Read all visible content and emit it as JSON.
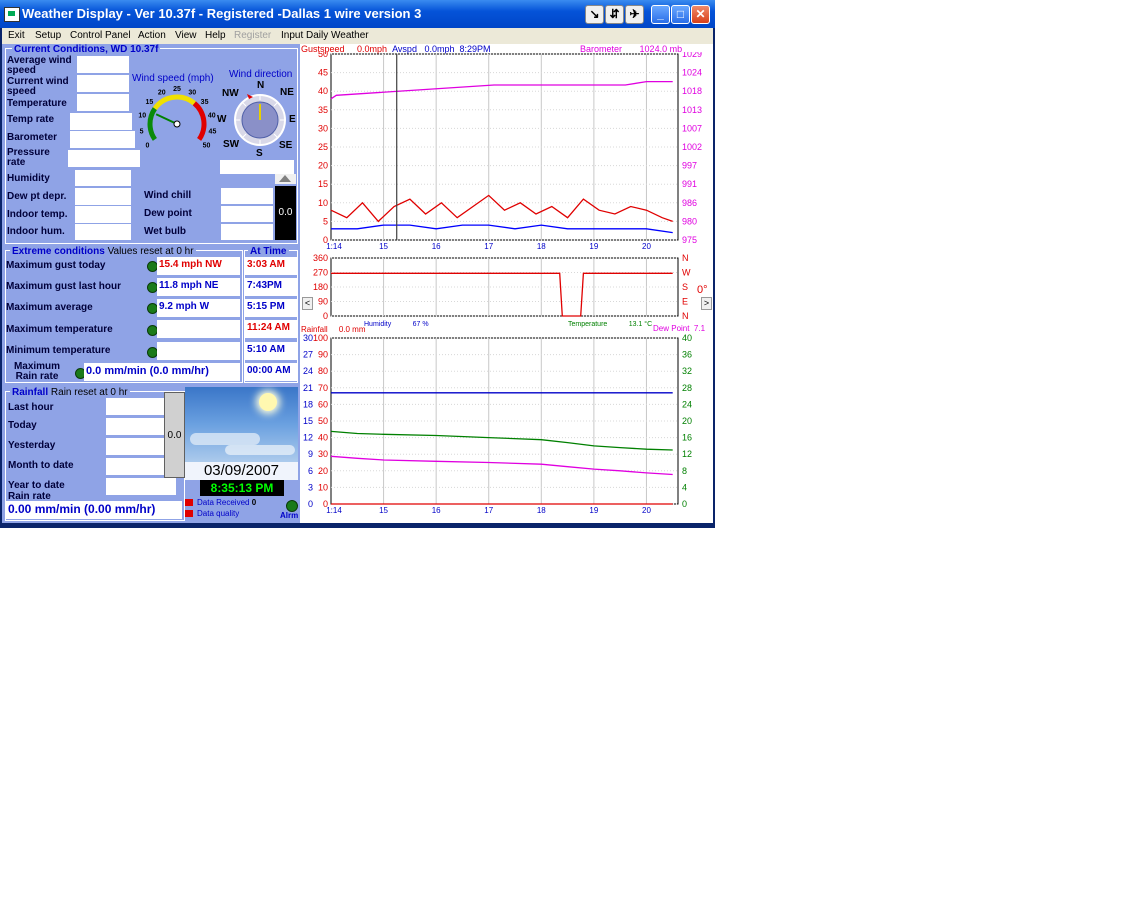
{
  "window": {
    "title": "Weather Display - Ver 10.37f - Registered  -Dallas 1 wire version 3"
  },
  "menu": [
    "Exit",
    "Setup",
    "Control Panel",
    "Action",
    "View",
    "Help",
    "Register",
    "Input Daily Weather"
  ],
  "current": {
    "title": "Current Conditions, WD 10.37f",
    "avg_wind_label": "Average wind speed",
    "cur_wind_label": "Current wind speed",
    "temperature_label": "Temperature",
    "temp_rate_label": "Temp rate",
    "barometer_label": "Barometer",
    "pressure_rate_label": "Pressure rate",
    "humidity_label": "Humidity",
    "dew_depr_label": "Dew pt depr.",
    "indoor_temp_label": "Indoor temp.",
    "indoor_hum_label": "Indoor hum.",
    "wind_chill_label": "Wind chill",
    "dew_point_label": "Dew point",
    "wet_bulb_label": "Wet bulb",
    "gauge_value": "0.0"
  },
  "wind_gauge": {
    "title": "Wind speed (mph)",
    "scale": [
      "0",
      "5",
      "10",
      "15",
      "20",
      "25",
      "30",
      "35",
      "40",
      "45",
      "50"
    ],
    "needle_value": 12
  },
  "wind_dir": {
    "title": "Wind direction",
    "N": "N",
    "NE": "NE",
    "E": "E",
    "SE": "SE",
    "S": "S",
    "SW": "SW",
    "W": "W",
    "NW": "NW"
  },
  "extremes": {
    "title": "Extreme conditions",
    "subtitle": "Values reset at 0 hr",
    "at_time": "At Time",
    "rows": [
      {
        "label": "Maximum gust today",
        "value": "15.4 mph NW",
        "time": "3:03 AM",
        "color": "#e00000"
      },
      {
        "label": "Maximum gust last hour",
        "value": "11.8 mph NE",
        "time": "7:43PM",
        "color": "#0000c8"
      },
      {
        "label": "Maximum average",
        "value": "9.2 mph W",
        "time": "5:15 PM",
        "color": "#0000c8"
      },
      {
        "label": "Maximum temperature",
        "value": "",
        "time": "11:24 AM",
        "color": "#e00000"
      },
      {
        "label": "Minimum temperature",
        "value": "",
        "time": "5:10 AM",
        "color": "#0000c8"
      },
      {
        "label": "Maximum Rain rate",
        "value": "0.0 mm/min (0.0 mm/hr)",
        "time": "00:00 AM",
        "color": "#0000c8"
      }
    ]
  },
  "rainfall": {
    "title": "Rainfall",
    "subtitle": "Rain reset at 0 hr",
    "rows": [
      "Last hour",
      "Today",
      "Yesterday",
      "Month to date",
      "Year to date"
    ],
    "gauge_value": "0.0",
    "rate_label": "Rain rate",
    "rate_value": "0.00 mm/min (0.00 mm/hr)"
  },
  "status": {
    "date": "03/09/2007",
    "time": "8:35:13 PM",
    "data_received_label": "Data Received",
    "data_received_value": "0",
    "data_quality_label": "Data quality",
    "alarm_label": "Alrm"
  },
  "colors": {
    "panel": "#8fa3e6",
    "accent": "#0000c8",
    "red": "#e00000",
    "green": "#008000",
    "magenta": "#e000e0",
    "clock_bg": "#000000",
    "clock_fg": "#00ff00"
  },
  "chart_data": [
    {
      "type": "line",
      "header": {
        "gust_label": "Gustspeed",
        "gust_value": "0.0mph",
        "avg_label": "Avspd",
        "avg_value": "0.0mph",
        "time": "8:29PM",
        "baro_label": "Barometer",
        "baro_value": "1024.0 mb"
      },
      "x_ticks": [
        "1:14",
        "15",
        "16",
        "17",
        "18",
        "19",
        "20"
      ],
      "y_left_ticks": [
        "0",
        "5",
        "10",
        "15",
        "20",
        "25",
        "30",
        "35",
        "40",
        "45",
        "50"
      ],
      "y_right_ticks": [
        "975",
        "980",
        "986",
        "991",
        "997",
        "1002",
        "1007",
        "1013",
        "1018",
        "1024",
        "1029"
      ],
      "ylim": [
        0,
        50
      ],
      "y2lim": [
        975,
        1029
      ],
      "series": [
        {
          "name": "Gustspeed",
          "color": "#e00000",
          "x": [
            14.0,
            14.3,
            14.6,
            14.9,
            15.2,
            15.5,
            15.8,
            16.1,
            16.4,
            16.7,
            17.0,
            17.3,
            17.6,
            17.9,
            18.2,
            18.5,
            18.8,
            19.1,
            19.4,
            19.7,
            20.0,
            20.3,
            20.5
          ],
          "y": [
            8,
            6,
            10,
            5,
            9,
            11,
            7,
            10,
            6,
            9,
            12,
            8,
            10,
            7,
            9,
            6,
            11,
            8,
            7,
            9,
            8,
            6,
            5
          ]
        },
        {
          "name": "Avspd",
          "color": "#0000ff",
          "x": [
            14.0,
            14.5,
            15.0,
            15.5,
            16.0,
            16.5,
            17.0,
            17.5,
            18.0,
            18.5,
            19.0,
            19.5,
            20.0,
            20.5
          ],
          "y": [
            3,
            3,
            4,
            4,
            3,
            4,
            4,
            3,
            4,
            3,
            3,
            3,
            3,
            2
          ]
        },
        {
          "name": "Barometer",
          "color": "#e000e0",
          "x": [
            14.0,
            14.1,
            17.1,
            19.6,
            20.0,
            20.5
          ],
          "y": [
            1016,
            1017,
            1020,
            1020,
            1021,
            1021
          ]
        }
      ]
    },
    {
      "type": "line",
      "x_ticks": [
        "15",
        "16",
        "17",
        "18",
        "19",
        "20"
      ],
      "y_left_ticks": [
        "0",
        "90",
        "180",
        "270",
        "360"
      ],
      "y_right_ticks": [
        "N",
        "E",
        "S",
        "W",
        "N"
      ],
      "right_readout": "0°",
      "ylim": [
        0,
        360
      ],
      "series": [
        {
          "name": "Wind direction",
          "color": "#e00000",
          "x": [
            14.0,
            15.0,
            16.0,
            17.0,
            18.0,
            18.35,
            18.4,
            18.75,
            18.8,
            19.5,
            20.5
          ],
          "y": [
            265,
            265,
            265,
            265,
            265,
            265,
            0,
            0,
            265,
            265,
            265
          ]
        }
      ]
    },
    {
      "type": "line",
      "header": {
        "rain_label": "Rainfall",
        "rain_value": "0.0 mm",
        "hum_label": "Humidity",
        "hum_value": "67 %",
        "temp_label": "Temperature",
        "temp_value": "13.1 °C",
        "dew_label": "Dew Point",
        "dew_value": "7.1"
      },
      "x_ticks": [
        "1:14",
        "15",
        "16",
        "17",
        "18",
        "19",
        "20"
      ],
      "y_left_ticks": [
        "0",
        "10",
        "20",
        "30",
        "40",
        "50",
        "60",
        "70",
        "80",
        "90",
        "100"
      ],
      "y_left2_ticks": [
        "0",
        "3",
        "6",
        "9",
        "12",
        "15",
        "18",
        "21",
        "24",
        "27",
        "30"
      ],
      "y_right_ticks": [
        "0",
        "4",
        "8",
        "12",
        "16",
        "20",
        "24",
        "28",
        "32",
        "36",
        "40"
      ],
      "ylim": [
        0,
        100
      ],
      "y2lim": [
        0,
        40
      ],
      "series": [
        {
          "name": "Humidity",
          "color": "#0000c8",
          "axis": "left",
          "x": [
            14.0,
            20.5
          ],
          "y": [
            67,
            67
          ]
        },
        {
          "name": "Temperature",
          "color": "#008000",
          "axis": "right",
          "x": [
            14.0,
            14.5,
            15.0,
            16.0,
            17.0,
            18.0,
            18.5,
            19.0,
            19.5,
            20.0,
            20.5
          ],
          "y": [
            17.5,
            17.0,
            16.8,
            16.5,
            16.0,
            15.5,
            14.8,
            14.0,
            13.6,
            13.2,
            13.0
          ]
        },
        {
          "name": "Dew Point",
          "color": "#e000e0",
          "axis": "right",
          "x": [
            14.0,
            14.5,
            15.0,
            16.0,
            17.0,
            18.0,
            18.5,
            19.0,
            19.5,
            20.0,
            20.5
          ],
          "y": [
            11.5,
            11.0,
            10.6,
            10.3,
            10.0,
            9.6,
            9.0,
            8.4,
            8.0,
            7.5,
            7.1
          ]
        },
        {
          "name": "Rainfall",
          "color": "#e00000",
          "axis": "left2",
          "x": [
            14.0,
            20.5
          ],
          "y": [
            0,
            0
          ]
        }
      ]
    }
  ]
}
